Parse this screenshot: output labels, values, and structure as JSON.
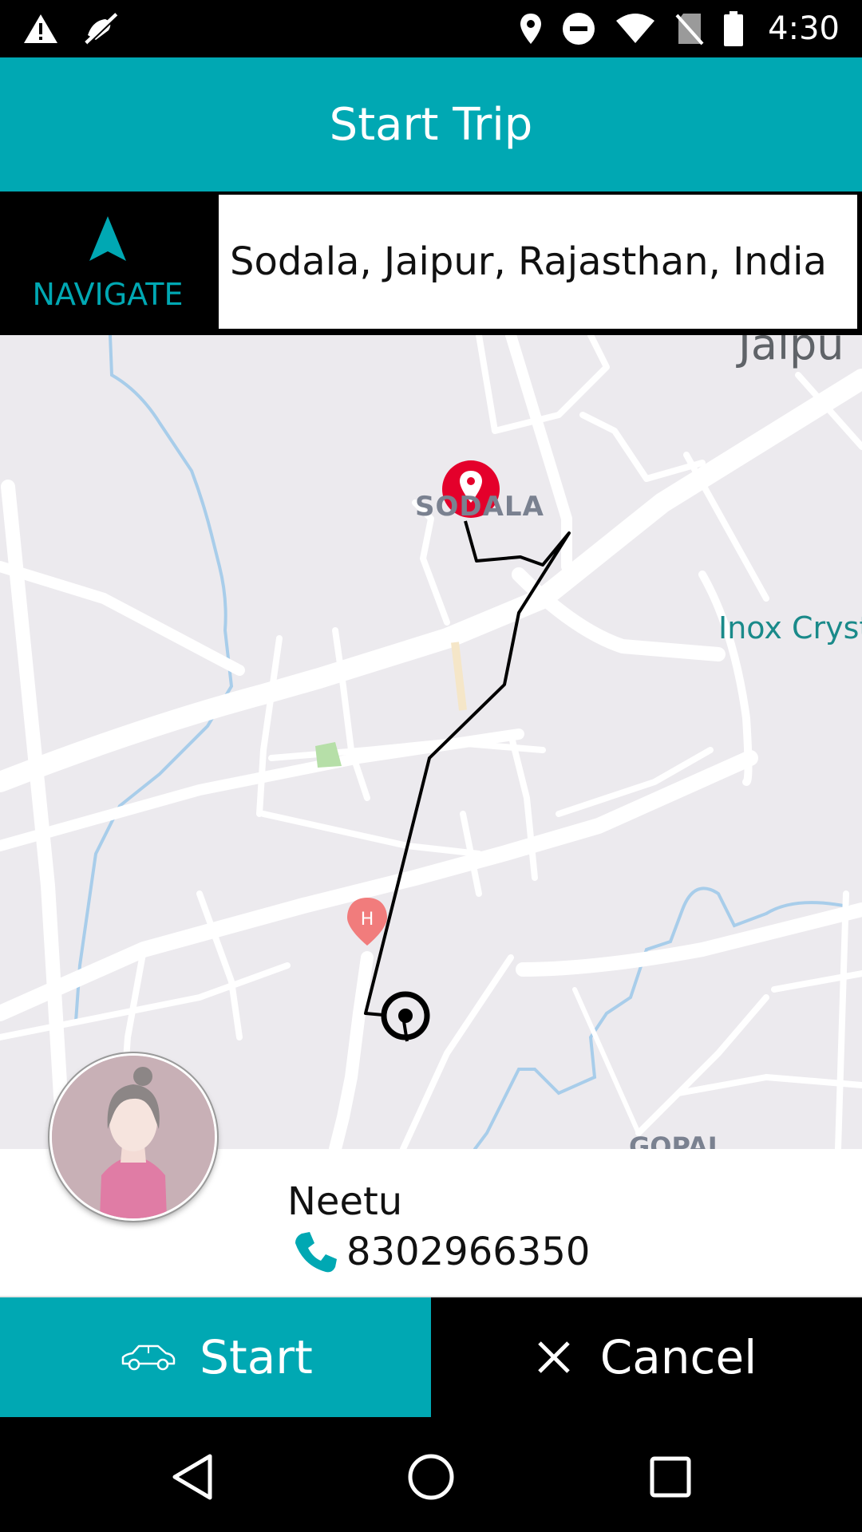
{
  "status_bar": {
    "time": "4:30",
    "icons": [
      "warning-icon",
      "silent-mode-icon",
      "location-icon",
      "do-not-disturb-icon",
      "wifi-icon",
      "no-sim-icon",
      "battery-icon"
    ]
  },
  "header": {
    "title": "Start Trip"
  },
  "navigate": {
    "label": "NAVIGATE",
    "icon": "navigation-arrow-icon"
  },
  "destination": {
    "address": "Sodala, Jaipur, Rajasthan, India"
  },
  "map": {
    "labels": {
      "jaipur": "Jaipu",
      "sodala": "SODALA",
      "inox": "Inox Crysta",
      "gopal": "GOPAL"
    },
    "colors": {
      "background": "#eceaee",
      "road": "#ffffff",
      "water": "#a8cdea",
      "route": "#000000",
      "pin": "#e4002b"
    }
  },
  "driver": {
    "name": "Neetu",
    "phone": "8302966350"
  },
  "actions": {
    "start_label": "Start",
    "cancel_label": "Cancel"
  },
  "colors": {
    "accent": "#00a8b3",
    "dark": "#000000"
  }
}
